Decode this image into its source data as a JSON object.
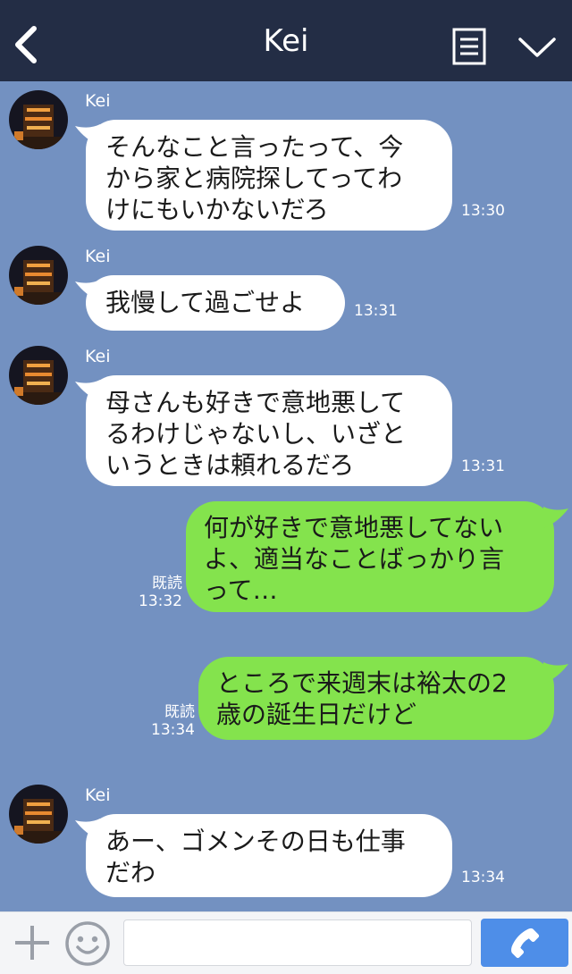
{
  "header": {
    "title": "Kei",
    "back_icon": "chevron-left-icon",
    "notes_icon": "notes-icon",
    "menu_icon": "chevron-down-icon",
    "background": "#232d45"
  },
  "chat": {
    "background": "#7391c1",
    "messages": [
      {
        "direction": "in",
        "sender": "Kei",
        "text": "そんなこと言ったって、今\nから家と病院探してってわ\nけにもいかないだろ",
        "time": "13:30"
      },
      {
        "direction": "in",
        "sender": "Kei",
        "text": "我慢して過ごせよ",
        "time": "13:31"
      },
      {
        "direction": "in",
        "sender": "Kei",
        "text": "母さんも好きで意地悪して\nるわけじゃないし、いざと\nいうときは頼れるだろ",
        "time": "13:31"
      },
      {
        "direction": "out",
        "read": "既読",
        "text": "何が好きで意地悪してない\nよ、適当なことばっかり言\nって…",
        "time": "13:32"
      },
      {
        "direction": "out",
        "read": "既読",
        "text": "ところで来週末は裕太の2\n歳の誕生日だけど",
        "time": "13:34"
      },
      {
        "direction": "in",
        "sender": "Kei",
        "text": "あー、ゴメンその日も仕事\nだわ",
        "time": "13:34"
      }
    ]
  },
  "input_bar": {
    "plus_icon": "plus-icon",
    "emoji_icon": "smiley-icon",
    "placeholder": "",
    "value": "",
    "call_icon": "phone-icon",
    "call_button_color": "#4e8ee8"
  },
  "colors": {
    "incoming_bubble": "#ffffff",
    "outgoing_bubble": "#84e34d"
  }
}
